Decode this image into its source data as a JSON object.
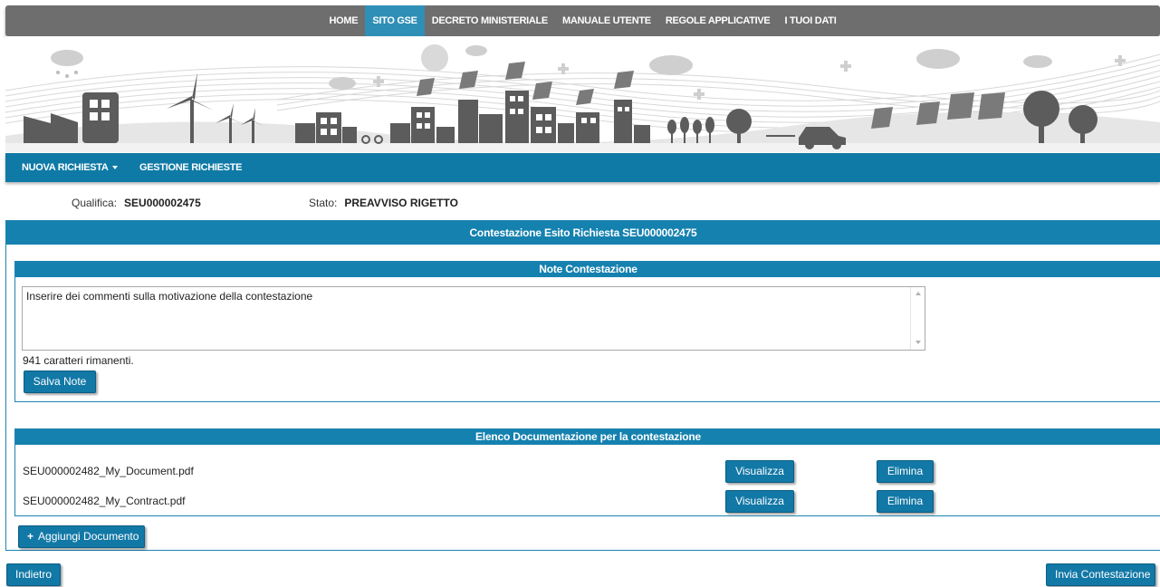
{
  "topnav": {
    "items": [
      "HOME",
      "SITO GSE",
      "DECRETO MINISTERIALE",
      "MANUALE UTENTE",
      "REGOLE APPLICATIVE",
      "I TUOI DATI"
    ],
    "active": "SITO GSE"
  },
  "subnav": {
    "new_request": "NUOVA RICHIESTA",
    "manage_requests": "GESTIONE RICHIESTE"
  },
  "info": {
    "qualifica_label": "Qualifica:",
    "qualifica_value": "SEU000002475",
    "stato_label": "Stato:",
    "stato_value": "PREAVVISO RIGETTO"
  },
  "panel": {
    "title": "Contestazione Esito Richiesta SEU000002475"
  },
  "notes": {
    "title": "Note Contestazione",
    "text": "Inserire dei commenti sulla motivazione della contestazione",
    "remaining": "941 caratteri rimanenti.",
    "save_label": "Salva Note"
  },
  "documents": {
    "title": "Elenco Documentazione per la contestazione",
    "rows": [
      {
        "name": "SEU000002482_My_Document.pdf",
        "view": "Visualizza",
        "delete": "Elimina"
      },
      {
        "name": "SEU000002482_My_Contract.pdf",
        "view": "Visualizza",
        "delete": "Elimina"
      }
    ],
    "add_label": "Aggiungi Documento"
  },
  "footer": {
    "back_label": "Indietro",
    "submit_label": "Invia Contestazione"
  },
  "colors": {
    "topnav_bg": "#6e6e6e",
    "active_tab": "#2f8fb6",
    "accent": "#1581af",
    "button": "#1278a6"
  }
}
